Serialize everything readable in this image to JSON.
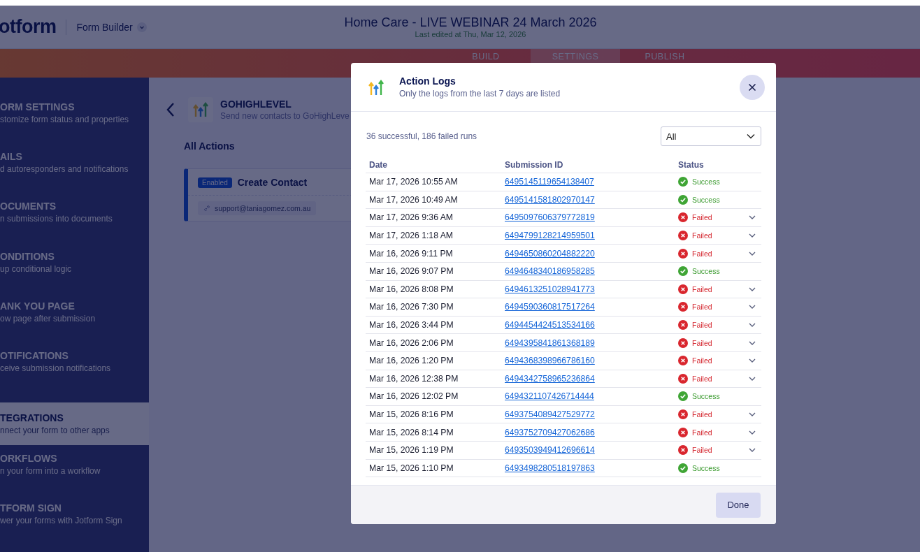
{
  "header": {
    "logo": "otform",
    "builder_menu": "Form Builder",
    "form_title": "Home Care - LIVE WEBINAR 24 March 2026",
    "last_edited": "Last edited at Thu, Mar 12, 2026"
  },
  "tabs": [
    {
      "label": "BUILD",
      "selected": false
    },
    {
      "label": "SETTINGS",
      "selected": true
    },
    {
      "label": "PUBLISH",
      "selected": false
    }
  ],
  "sidebar": {
    "items": [
      {
        "title": "ORM SETTINGS",
        "subtitle": "stomize form status and properties",
        "selected": false
      },
      {
        "title": "AILS",
        "subtitle": "d autoresponders and notifications",
        "selected": false
      },
      {
        "title": "OCUMENTS",
        "subtitle": "n submissions into documents",
        "selected": false
      },
      {
        "title": "ONDITIONS",
        "subtitle": "up conditional logic",
        "selected": false
      },
      {
        "title": "ANK YOU PAGE",
        "subtitle": "ow page after submission",
        "selected": false
      },
      {
        "title": "OTIFICATIONS",
        "subtitle": "ceive submission notifications",
        "selected": false
      },
      {
        "title": "TEGRATIONS",
        "subtitle": "nnect your form to other apps",
        "selected": true
      },
      {
        "title": "ORKFLOWS",
        "subtitle": "n your form into a workflow",
        "selected": false
      },
      {
        "title": "TFORM SIGN",
        "subtitle": "wer your forms with Jotform Sign",
        "selected": false
      }
    ]
  },
  "integration": {
    "name": "GOHIGHLEVEL",
    "description": "Send new contacts to GoHighLeve",
    "section_title": "All Actions",
    "action": {
      "badge": "Enabled",
      "enabled": true,
      "title": "Create Contact",
      "account": "support@taniagomez.com.au"
    }
  },
  "modal": {
    "title": "Action Logs",
    "subtitle": "Only the logs from the last 7 days are listed",
    "summary": "36 successful, 186 failed runs",
    "filter": "All",
    "columns": [
      "Date",
      "Submission ID",
      "Status"
    ],
    "rows": [
      {
        "date": "Mar 17, 2026 10:55 AM",
        "id": "6495145119654138407",
        "status": "Success",
        "kind": "success"
      },
      {
        "date": "Mar 17, 2026 10:49 AM",
        "id": "6495141581802970147",
        "status": "Success",
        "kind": "success"
      },
      {
        "date": "Mar 17, 2026 9:36 AM",
        "id": "6495097606379772819",
        "status": "Failed",
        "kind": "failed"
      },
      {
        "date": "Mar 17, 2026 1:18 AM",
        "id": "6494799128214959501",
        "status": "Failed",
        "kind": "failed"
      },
      {
        "date": "Mar 16, 2026 9:11 PM",
        "id": "6494650860204882220",
        "status": "Failed",
        "kind": "failed"
      },
      {
        "date": "Mar 16, 2026 9:07 PM",
        "id": "6494648340186958285",
        "status": "Success",
        "kind": "success"
      },
      {
        "date": "Mar 16, 2026 8:08 PM",
        "id": "6494613251028941773",
        "status": "Failed",
        "kind": "failed"
      },
      {
        "date": "Mar 16, 2026 7:30 PM",
        "id": "6494590360817517264",
        "status": "Failed",
        "kind": "failed"
      },
      {
        "date": "Mar 16, 2026 3:44 PM",
        "id": "6494454424513534166",
        "status": "Failed",
        "kind": "failed"
      },
      {
        "date": "Mar 16, 2026 2:06 PM",
        "id": "6494395841861368189",
        "status": "Failed",
        "kind": "failed"
      },
      {
        "date": "Mar 16, 2026 1:20 PM",
        "id": "6494368398966786160",
        "status": "Failed",
        "kind": "failed"
      },
      {
        "date": "Mar 16, 2026 12:38 PM",
        "id": "6494342758965236864",
        "status": "Failed",
        "kind": "failed"
      },
      {
        "date": "Mar 16, 2026 12:02 PM",
        "id": "6494321107426714444",
        "status": "Success",
        "kind": "success"
      },
      {
        "date": "Mar 15, 2026 8:16 PM",
        "id": "6493754089427529772",
        "status": "Failed",
        "kind": "failed"
      },
      {
        "date": "Mar 15, 2026 8:14 PM",
        "id": "6493752709427062686",
        "status": "Failed",
        "kind": "failed"
      },
      {
        "date": "Mar 15, 2026 1:19 PM",
        "id": "6493503949412696614",
        "status": "Failed",
        "kind": "failed"
      },
      {
        "date": "Mar 15, 2026 1:10 PM",
        "id": "6493498280518197863",
        "status": "Success",
        "kind": "success"
      }
    ],
    "done_button": "Done"
  }
}
